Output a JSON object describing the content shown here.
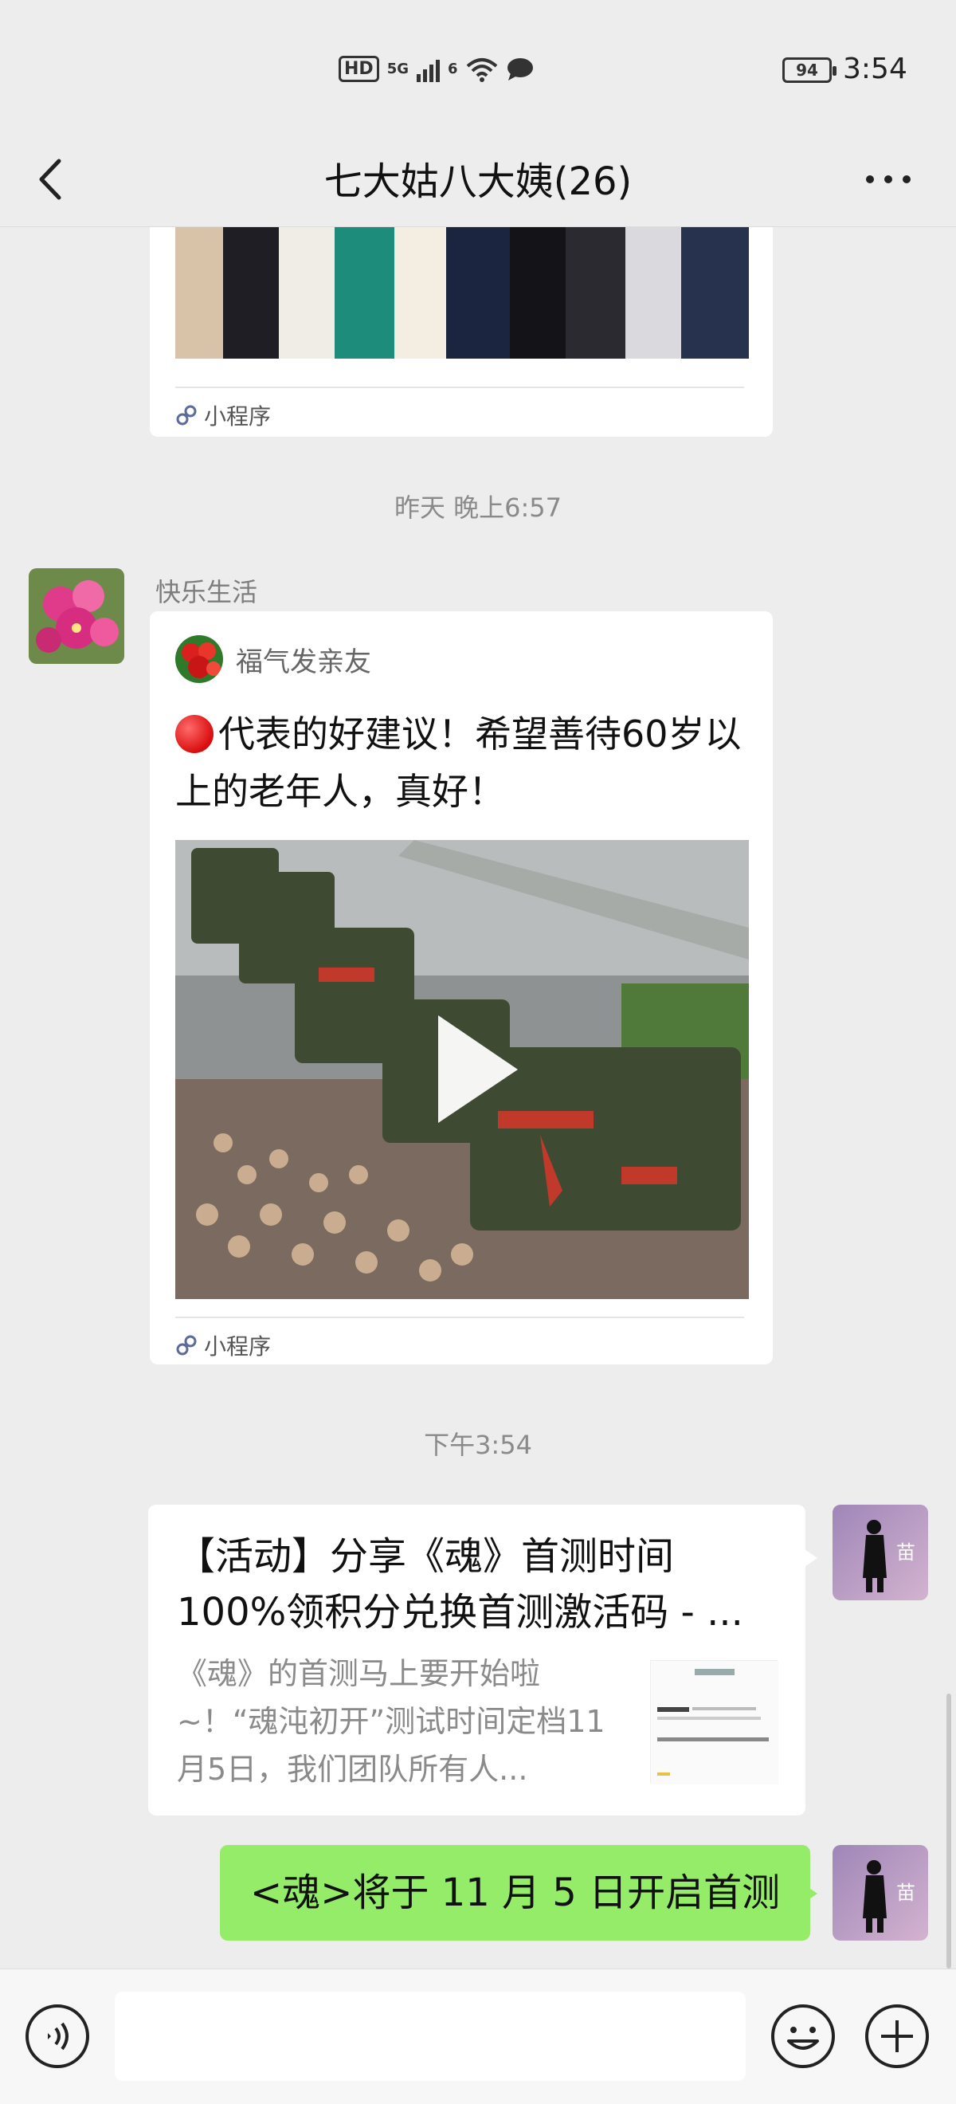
{
  "status_bar": {
    "hd": "HD",
    "network": "5G",
    "wifi_badge": "6",
    "battery": "94",
    "time": "3:54"
  },
  "header": {
    "title": "七大姑八大姨(26)",
    "back_icon": "chevron-left-icon",
    "more_icon": "more-dots-icon"
  },
  "messages": {
    "first_card": {
      "footer_label": "小程序"
    },
    "time_1": "昨天 晚上6:57",
    "post": {
      "sender": "快乐生活",
      "source_name": "福气发亲友",
      "title": "代表的好建议！希望善待60岁以上的老年人，真好！",
      "footer_label": "小程序"
    },
    "time_2": "下午3:54",
    "share": {
      "title": "【活动】分享《魂》首测时间100%领积分兑换首测激活码 - ...",
      "desc": "《魂》的首测马上要开始啦~！“魂沌初开”测试时间定档11月5日，我们团队所有人...",
      "avatar_char": "苗"
    },
    "text": {
      "content": "<魂>将于 11 月 5 日开启首测",
      "avatar_char": "苗"
    }
  },
  "input_bar": {
    "voice_icon": "voice-icon",
    "emoji_icon": "emoji-icon",
    "plus_icon": "plus-icon",
    "placeholder": ""
  },
  "colors": {
    "background": "#ededed",
    "self_bubble": "#95ec69",
    "card": "#ffffff"
  }
}
